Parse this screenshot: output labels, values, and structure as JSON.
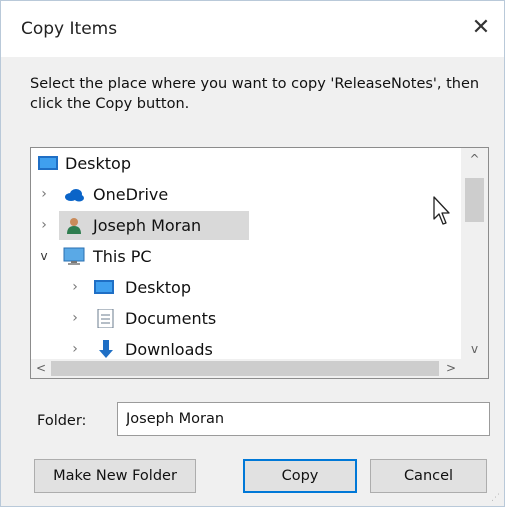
{
  "dialog": {
    "title": "Copy Items",
    "close_glyph": "✕",
    "instruction": "Select the place where you want to copy 'ReleaseNotes', then click the Copy button."
  },
  "tree": {
    "items": [
      {
        "label": "Desktop",
        "icon": "desktop-icon",
        "level": 0,
        "expander": "none"
      },
      {
        "label": "OneDrive",
        "icon": "onedrive-cloud-icon",
        "level": 0,
        "expander": "collapsed"
      },
      {
        "label": "Joseph Moran",
        "icon": "user-folder-icon",
        "level": 0,
        "expander": "collapsed",
        "selected": true
      },
      {
        "label": "This PC",
        "icon": "computer-icon",
        "level": 0,
        "expander": "expanded"
      },
      {
        "label": "Desktop",
        "icon": "desktop-icon",
        "level": 1,
        "expander": "collapsed"
      },
      {
        "label": "Documents",
        "icon": "documents-icon",
        "level": 1,
        "expander": "collapsed"
      },
      {
        "label": "Downloads",
        "icon": "downloads-icon",
        "level": 1,
        "expander": "collapsed",
        "partially_visible": true
      }
    ],
    "scroll_up": "^",
    "scroll_down": "v",
    "scroll_left": "<",
    "scroll_right": ">"
  },
  "folder": {
    "label": "Folder:",
    "value": "Joseph Moran"
  },
  "buttons": {
    "make_new_folder": "Make New Folder",
    "copy": "Copy",
    "cancel": "Cancel"
  },
  "colors": {
    "accent": "#0078d7",
    "selection": "#d9d9d9",
    "dialog_bg": "#f0f0f0"
  }
}
